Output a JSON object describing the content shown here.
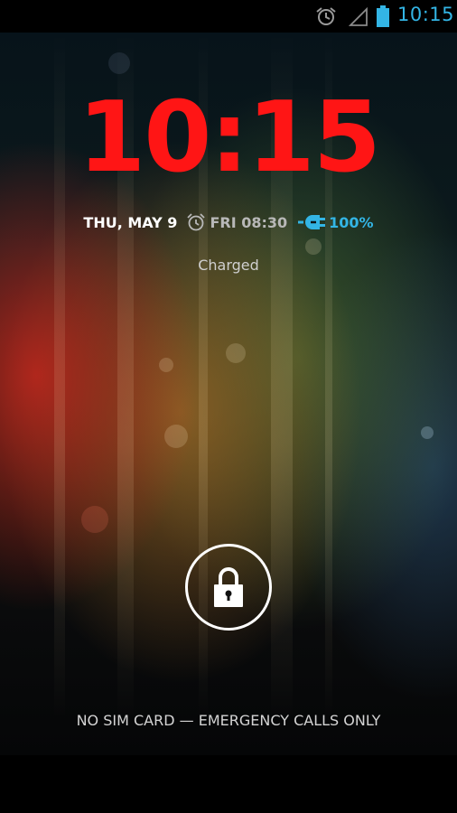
{
  "status_bar": {
    "time": "10:15",
    "icons": [
      "alarm-icon",
      "signal-icon",
      "battery-icon"
    ],
    "accent": "#33b5e5"
  },
  "lockscreen": {
    "clock": "10:15",
    "clock_color": "#ff1515",
    "date": "THU, MAY 9",
    "next_alarm": "FRI 08:30",
    "battery_percent": "100%",
    "charging_status": "Charged",
    "unlock_icon": "lock-icon",
    "carrier_text": "NO SIM CARD — EMERGENCY CALLS ONLY"
  }
}
